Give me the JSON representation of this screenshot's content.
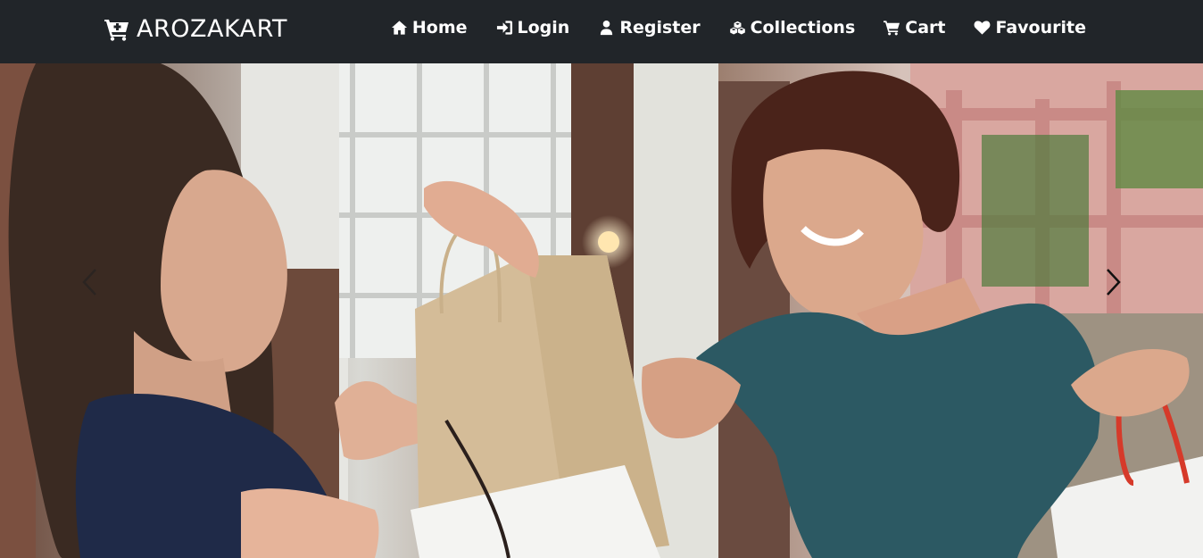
{
  "brand": {
    "name": "AROZAKART",
    "icon": "cart-plus-icon"
  },
  "nav": {
    "items": [
      {
        "label": "Home",
        "icon": "home-icon"
      },
      {
        "label": "Login",
        "icon": "sign-in-icon"
      },
      {
        "label": "Register",
        "icon": "user-icon"
      },
      {
        "label": "Collections",
        "icon": "cubes-icon"
      },
      {
        "label": "Cart",
        "icon": "cart-icon"
      },
      {
        "label": "Favourite",
        "icon": "heart-icon"
      }
    ]
  },
  "hero": {
    "image": "shopping-bags-hero-photo",
    "controls": {
      "prev": "chevron-left-icon",
      "next": "chevron-right-icon"
    }
  },
  "colors": {
    "navbar": "#212529",
    "text": "#ffffff"
  }
}
